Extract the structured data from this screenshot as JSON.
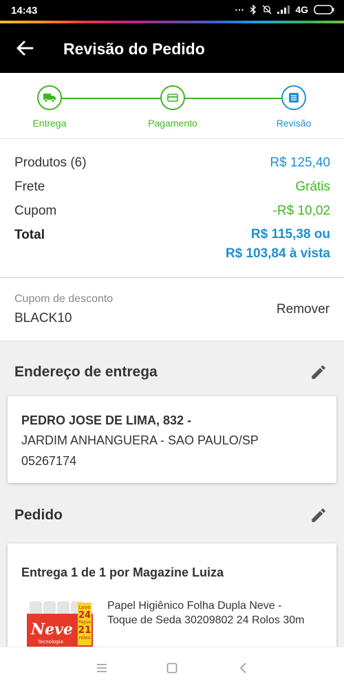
{
  "status_bar": {
    "time": "14:43",
    "network": "4G"
  },
  "header": {
    "title": "Revisão do Pedido"
  },
  "stepper": {
    "steps": [
      {
        "label": "Entrega",
        "icon": "truck-icon"
      },
      {
        "label": "Pagamento",
        "icon": "card-icon"
      },
      {
        "label": "Revisão",
        "icon": "list-icon"
      }
    ]
  },
  "summary": {
    "products_label": "Produtos (6)",
    "products_value": "R$ 125,40",
    "shipping_label": "Frete",
    "shipping_value": "Grátis",
    "coupon_label": "Cupom",
    "coupon_value": "-R$ 10,02",
    "total_label": "Total",
    "total_value_line1": "R$ 115,38 ou",
    "total_value_line2": "R$ 103,84 à vista"
  },
  "coupon": {
    "label": "Cupom de desconto",
    "code": "BLACK10",
    "remove_label": "Remover"
  },
  "address": {
    "heading": "Endereço de entrega",
    "line1": "PEDRO JOSE DE LIMA, 832 -",
    "line2": "JARDIM ANHANGUERA - SAO PAULO/SP",
    "line3": "05267174"
  },
  "order": {
    "heading": "Pedido",
    "delivery_title": "Entrega 1 de 1 por Magazine Luiza",
    "product_name": "Papel Higiênico Folha Dupla Neve - Toque de Seda 30209802 24 Rolos 30m",
    "product_image_text": {
      "brand": "Neve",
      "badge_top": "Leve",
      "badge_top_num": "24",
      "badge_mid": "Pague",
      "badge_num": "21",
      "badge_bottom": "rolos",
      "subtitle": "Tecnologia"
    }
  },
  "colors": {
    "green": "#3cb81c",
    "blue": "#1e8fcf",
    "header": "#000000"
  }
}
